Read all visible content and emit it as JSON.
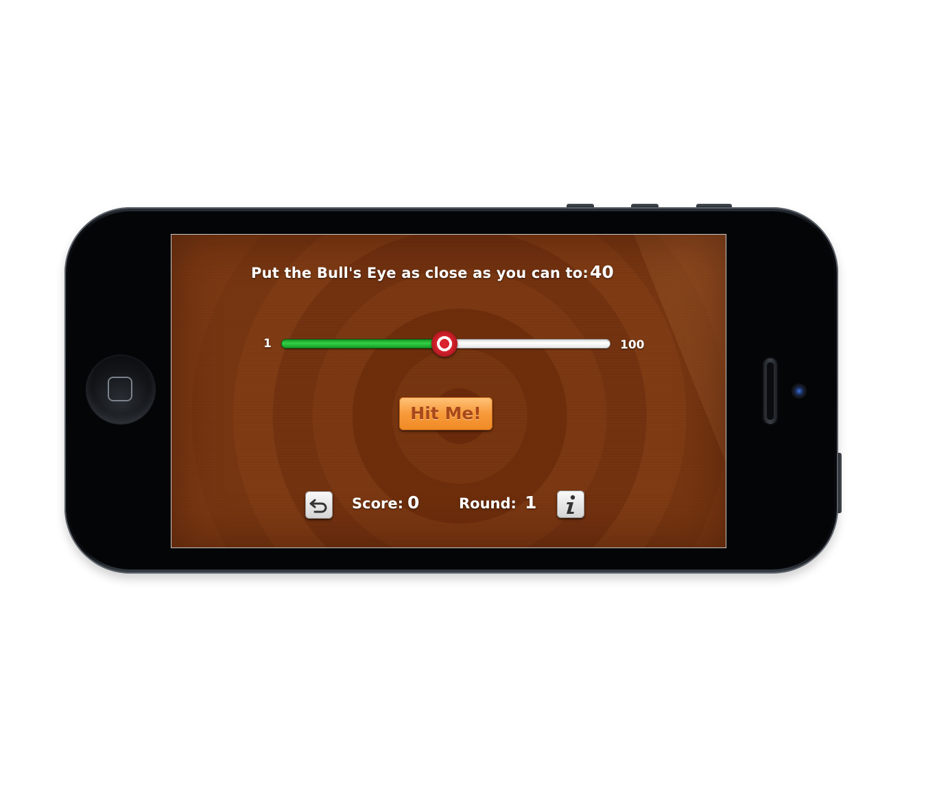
{
  "game": {
    "prompt": "Put the Bull's Eye as close as you can to:",
    "target_value": "40"
  },
  "slider": {
    "min_label": "1",
    "max_label": "100",
    "value": 50,
    "min": 1,
    "max": 100
  },
  "hit_button": {
    "label": "Hit Me!"
  },
  "status_bar": {
    "score_label": "Score:",
    "score_value": "0",
    "round_label": "Round:",
    "round_value": "1"
  },
  "icons": {
    "start_over": "undo-arrow-icon",
    "info": "info-icon"
  },
  "colors": {
    "background": "#7a3512",
    "slider_fill": "#2fc442",
    "button": "#f79a3a",
    "button_text": "#a8481b",
    "thumb": "#d9232f"
  }
}
